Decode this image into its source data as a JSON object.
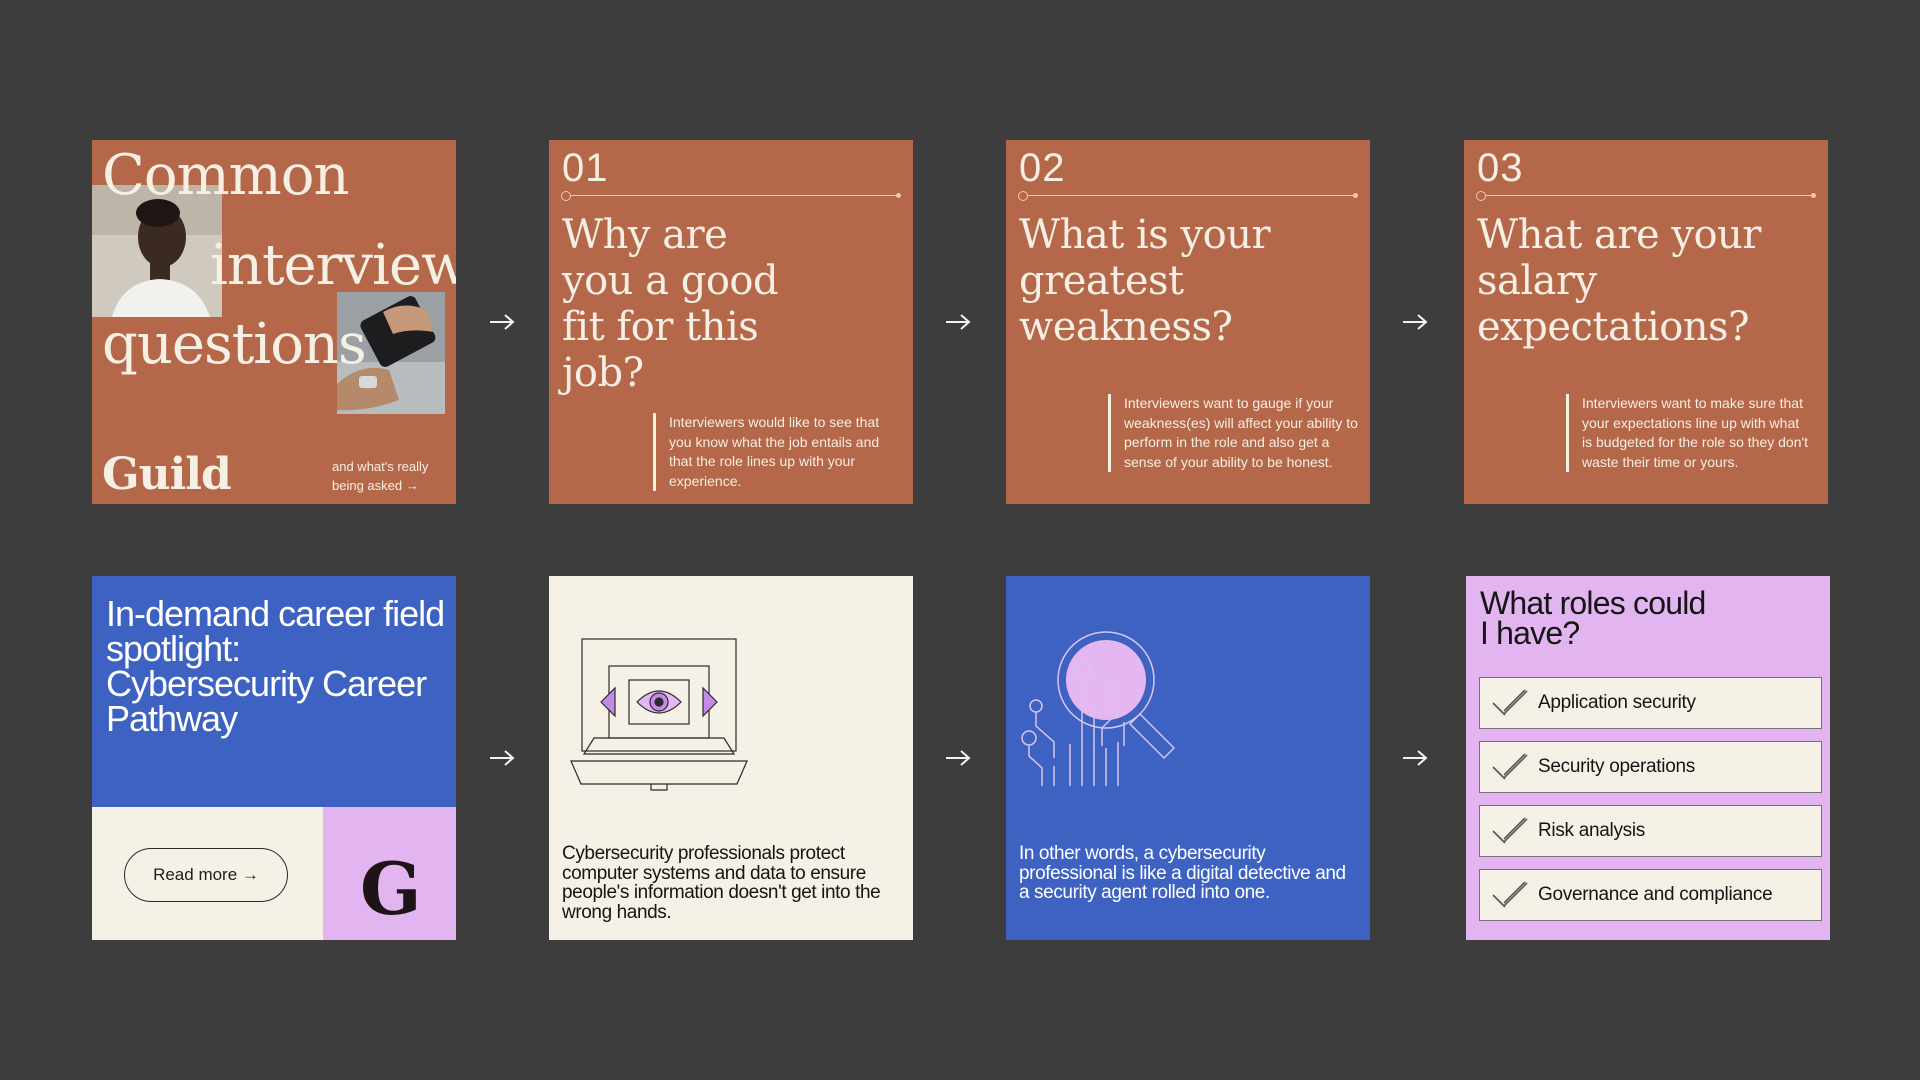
{
  "cover": {
    "title_line1": "Common",
    "title_line2": "interview",
    "title_line3": "questions",
    "brand": "Guild",
    "subtitle": "and what's really being asked →"
  },
  "questions": [
    {
      "number": "01",
      "title": "Why are you a good fit for this job?",
      "body": "Interviewers would like to see that you know what the job entails and that the role lines up with your experience."
    },
    {
      "number": "02",
      "title": "What is your greatest weakness?",
      "body": "Interviewers want to gauge if your weakness(es) will affect your ability to perform in the role and also get a sense of your ability to be honest."
    },
    {
      "number": "03",
      "title": "What are your salary expectations?",
      "body": "Interviewers want to make sure that your expectations line up with what is budgeted for the role so they don't waste their time or yours."
    }
  ],
  "spotlight": {
    "title": "In-demand career field spotlight: Cybersecurity Career Pathway",
    "read_more": "Read more →",
    "logo_letter": "G"
  },
  "protect": {
    "text": "Cybersecurity professionals protect computer systems and data to ensure people's information doesn't get into the wrong hands."
  },
  "detective": {
    "text": "In other words, a cybersecurity professional is like a digital detective and a security agent rolled into one."
  },
  "roles": {
    "title": "What roles could I have?",
    "items": [
      "Application security",
      "Security operations",
      "Risk analysis",
      "Governance and compliance"
    ]
  },
  "colors": {
    "background": "#3d3d3d",
    "rust": "#b5674a",
    "blue": "#3d62c2",
    "cream": "#f5f1e6",
    "lilac": "#e2b4f0"
  },
  "icons": [
    "arrow-right-icon",
    "laptop-eye-icon",
    "magnifier-circuit-icon",
    "checkmark-icon"
  ]
}
